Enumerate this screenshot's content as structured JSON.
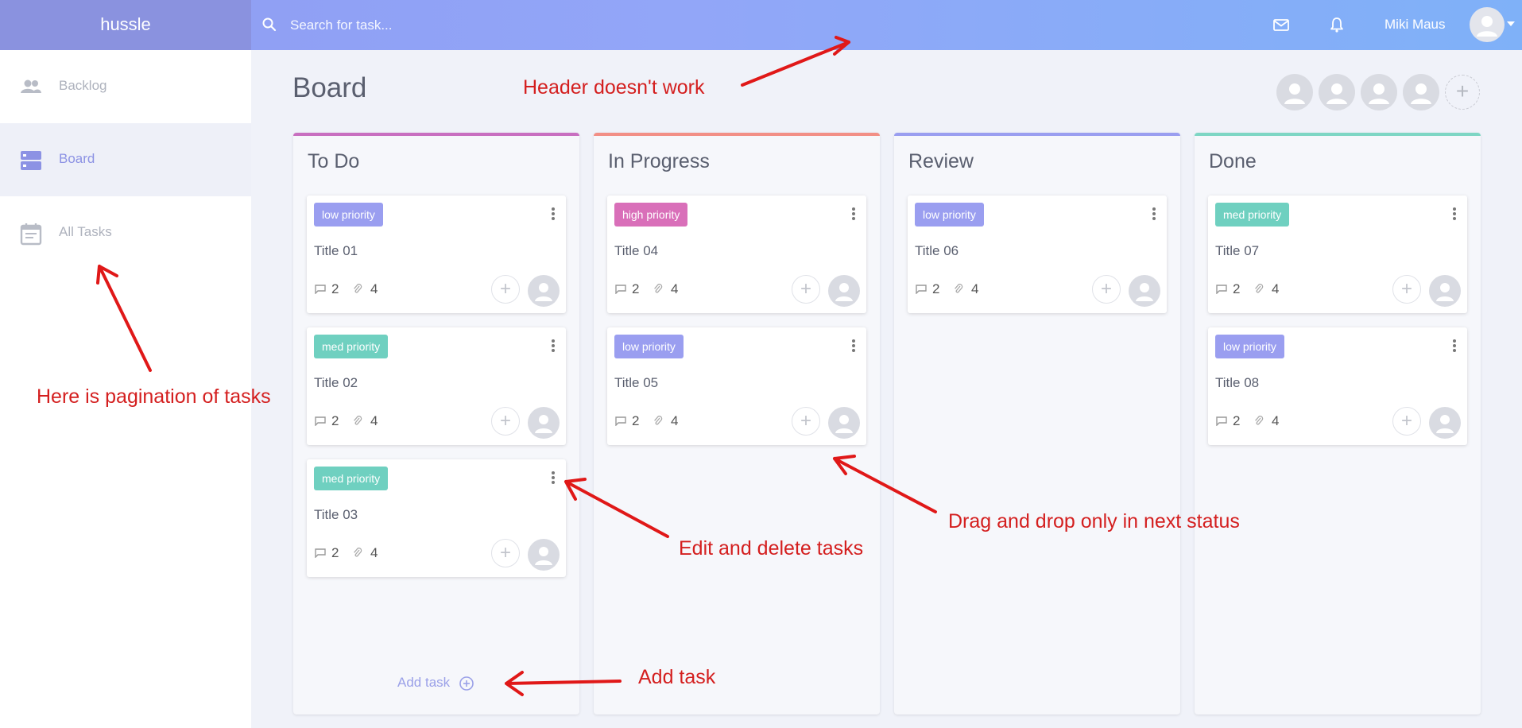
{
  "app": {
    "brand": "hussle"
  },
  "header": {
    "search_placeholder": "Search for task...",
    "user_name": "Miki Maus",
    "icons": [
      "search-icon",
      "mail-icon",
      "bell-icon",
      "avatar",
      "chevron-down-icon"
    ]
  },
  "sidebar": {
    "items": [
      {
        "label": "Backlog",
        "icon": "people-icon",
        "active": false
      },
      {
        "label": "Board",
        "icon": "board-icon",
        "active": true
      },
      {
        "label": "All Tasks",
        "icon": "calendar-icon",
        "active": false
      }
    ]
  },
  "page": {
    "title": "Board",
    "member_count": 4
  },
  "board": {
    "columns": [
      {
        "title": "To Do",
        "accent": "#c86fc0",
        "cards": [
          {
            "priority": "low priority",
            "priority_color": "#9a9ef0",
            "title": "Title 01",
            "comments": "2",
            "attachments": "4"
          },
          {
            "priority": "med priority",
            "priority_color": "#6fd0c0",
            "title": "Title 02",
            "comments": "2",
            "attachments": "4"
          },
          {
            "priority": "med priority",
            "priority_color": "#6fd0c0",
            "title": "Title 03",
            "comments": "2",
            "attachments": "4"
          }
        ]
      },
      {
        "title": "In Progress",
        "accent": "#f28f86",
        "cards": [
          {
            "priority": "high priority",
            "priority_color": "#d96fb9",
            "title": "Title 04",
            "comments": "2",
            "attachments": "4"
          },
          {
            "priority": "low priority",
            "priority_color": "#9a9ef0",
            "title": "Title 05",
            "comments": "2",
            "attachments": "4"
          }
        ]
      },
      {
        "title": "Review",
        "accent": "#9a9ef0",
        "cards": [
          {
            "priority": "low priority",
            "priority_color": "#9a9ef0",
            "title": "Title 06",
            "comments": "2",
            "attachments": "4"
          }
        ]
      },
      {
        "title": "Done",
        "accent": "#7ed6c4",
        "cards": [
          {
            "priority": "med priority",
            "priority_color": "#6fd0c0",
            "title": "Title 07",
            "comments": "2",
            "attachments": "4"
          },
          {
            "priority": "low priority",
            "priority_color": "#9a9ef0",
            "title": "Title 08",
            "comments": "2",
            "attachments": "4"
          }
        ]
      }
    ],
    "add_task_label": "Add task"
  },
  "annotations": {
    "header": "Header doesn't work",
    "pagination": "Here is pagination of tasks",
    "edit": "Edit and delete tasks",
    "drag": "Drag and drop only in next status",
    "add": "Add task",
    "color": "#d41f1f"
  }
}
